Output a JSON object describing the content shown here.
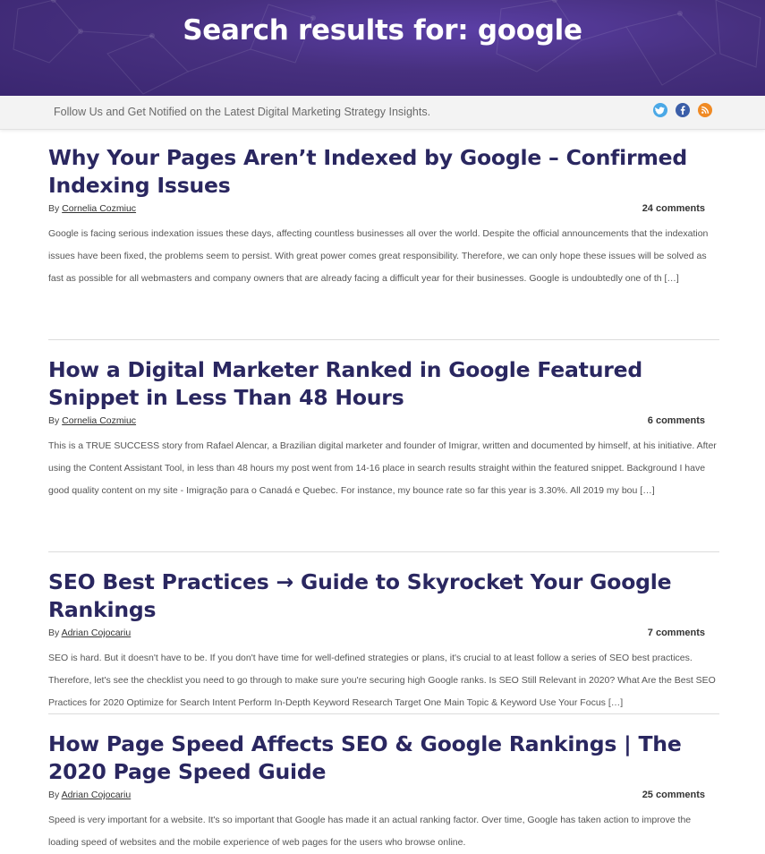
{
  "header": {
    "title": "Search results for: google"
  },
  "followbar": {
    "tagline": "Follow Us and Get Notified on the Latest Digital Marketing Strategy Insights.",
    "social": [
      {
        "icon": "twitter-icon",
        "color": "#4aa8e6"
      },
      {
        "icon": "facebook-icon",
        "color": "#3b5ea8"
      },
      {
        "icon": "rss-icon",
        "color": "#f08a24"
      }
    ]
  },
  "posts": [
    {
      "title": "Why Your Pages Aren’t Indexed by Google – Confirmed Indexing Issues",
      "by": "By ",
      "author": "Cornelia Cozmiuc",
      "comments": "24 comments",
      "excerpt": "Google is facing serious indexation issues these days, affecting countless businesses all over the world.  Despite the official announcements that the indexation issues have been fixed, the problems seem to persist.   With great power comes great responsibility. Therefore, we can only hope these issues will be solved as fast as possible for all webmasters and company owners that are already facing a difficult year for their businesses.     Google is undoubtedly one of th […]"
    },
    {
      "title": "How a Digital Marketer Ranked in Google Featured Snippet in Less Than 48 Hours",
      "by": "By ",
      "author": "Cornelia Cozmiuc",
      "comments": "6 comments",
      "excerpt": "This is a TRUE SUCCESS story from Rafael Alencar, a Brazilian digital marketer and founder of Imigrar, written and documented by himself, at his initiative.    After using the Content Assistant Tool, in less than 48 hours my post went from 14-16 place in search results straight within the featured snippet.     Background I have good quality content on my site - Imigração para o Canadá e Quebec. For instance, my bounce rate so far this year is 3.30%. All 2019 my bou […]"
    },
    {
      "title": "SEO Best Practices → Guide to Skyrocket Your Google Rankings",
      "by": "By ",
      "author": "Adrian Cojocariu",
      "comments": "7 comments",
      "excerpt": "SEO is hard. But it doesn't have to be. If you don't have time for well-defined strategies or plans, it's crucial to at least follow a series of SEO best practices.   Therefore, let's see the checklist you need to go through to make sure you're securing high Google ranks.     Is SEO Still Relevant in 2020? What Are the Best SEO Practices for 2020 Optimize for Search Intent Perform In-Depth Keyword Research Target One Main Topic & Keyword Use Your Focus […]"
    },
    {
      "title": "How Page Speed Affects SEO & Google Rankings | The 2020 Page Speed Guide",
      "by": "By ",
      "author": "Adrian Cojocariu",
      "comments": "25 comments",
      "excerpt": "Speed is very important for a website. It's so important that Google has made it an actual ranking factor. Over time, Google has taken action to improve the loading speed of websites and the mobile experience of web pages for the users who browse online."
    }
  ]
}
